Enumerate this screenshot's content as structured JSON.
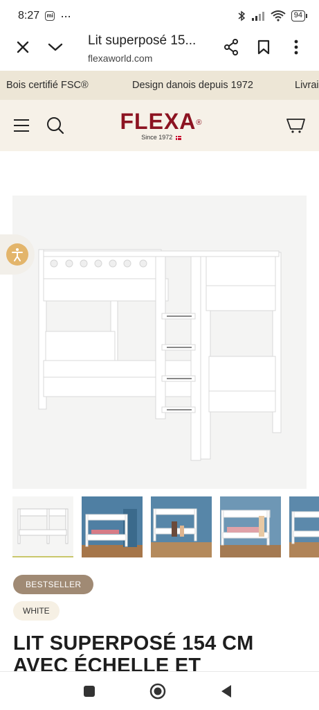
{
  "status_bar": {
    "time": "8:27",
    "dots": "···",
    "mi_label": "mi",
    "battery": "94"
  },
  "browser": {
    "page_title": "Lit superposé 15...",
    "domain": "flexaworld.com"
  },
  "announcement": [
    "Bois certifié FSC®",
    "Design danois depuis 1972",
    "Livrai"
  ],
  "header": {
    "logo": "FLEXA",
    "logo_mark": "®",
    "tagline": "Since 1972"
  },
  "badges": {
    "bestseller": "BESTSELLER",
    "color": "WHITE"
  },
  "product": {
    "title": "LIT SUPERPOSÉ 154 CM AVEC ÉCHELLE ET"
  },
  "icons": [
    "close-icon",
    "chevron-down-icon",
    "share-icon",
    "bookmark-icon",
    "more-vert-icon",
    "menu-icon",
    "search-icon",
    "cart-icon",
    "accessibility-icon",
    "nav-recents-icon",
    "nav-home-icon",
    "nav-back-icon"
  ],
  "colors": {
    "brand": "#8c1321",
    "strip": "#ede6d6",
    "header_bg": "#f6f1e8",
    "bestseller": "#a08a74"
  }
}
